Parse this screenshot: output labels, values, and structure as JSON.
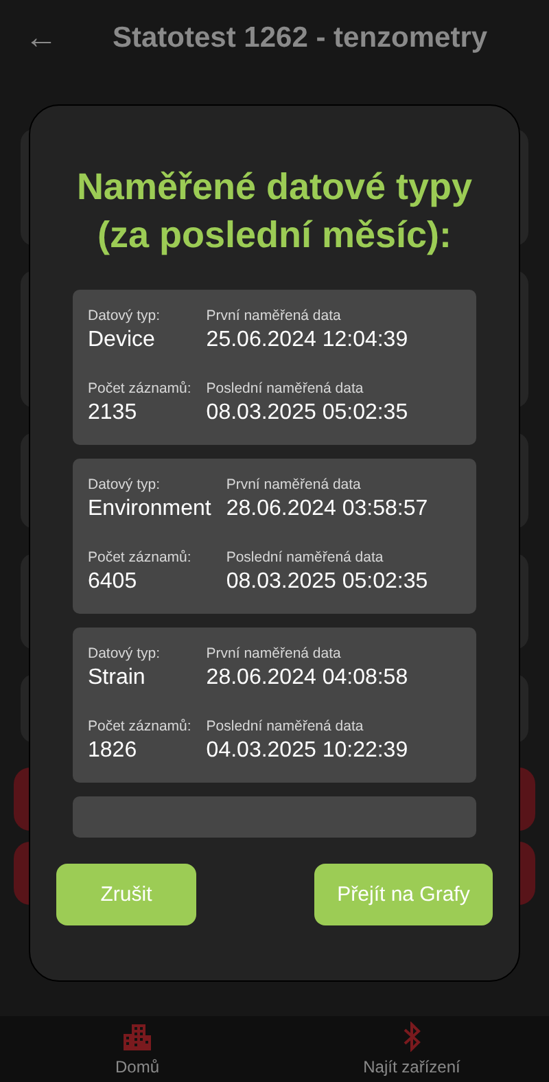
{
  "header": {
    "back": "←",
    "title": "Statotest 1262 - tenzometry"
  },
  "dialog": {
    "title": "Naměřené datové typy (za poslední měsíc):",
    "records": [
      {
        "type_label": "Datový typ:",
        "type": "Device",
        "first_label": "První naměřená data",
        "first": "25.06.2024 12:04:39",
        "count_label": "Počet záznamů:",
        "count": "2135",
        "last_label": "Poslední naměřená data",
        "last": "08.03.2025 05:02:35"
      },
      {
        "type_label": "Datový typ:",
        "type": "Environment",
        "first_label": "První naměřená data",
        "first": "28.06.2024 03:58:57",
        "count_label": "Počet záznamů:",
        "count": "6405",
        "last_label": "Poslední naměřená data",
        "last": "08.03.2025 05:02:35"
      },
      {
        "type_label": "Datový typ:",
        "type": "Strain",
        "first_label": "První naměřená data",
        "first": "28.06.2024 04:08:58",
        "count_label": "Počet záznamů:",
        "count": "1826",
        "last_label": "Poslední naměřená data",
        "last": "04.03.2025 10:22:39"
      }
    ],
    "buttons": [
      {
        "label": "Zrušit"
      },
      {
        "label": "Přejít na Grafy"
      }
    ]
  },
  "nav": [
    {
      "label": "Domů",
      "kind": "home"
    },
    {
      "label": "Najít zařízení",
      "kind": "bluetooth"
    }
  ]
}
